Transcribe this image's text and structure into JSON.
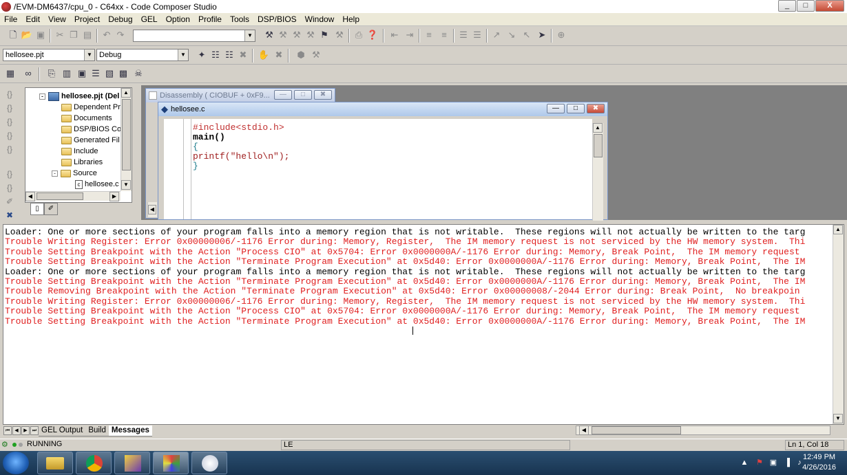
{
  "window": {
    "title": "/EVM-DM6437/cpu_0 - C64xx - Code Composer Studio",
    "min": "_",
    "max": "□",
    "close": "X"
  },
  "menu": [
    "File",
    "Edit",
    "View",
    "Project",
    "Debug",
    "GEL",
    "Option",
    "Profile",
    "Tools",
    "DSP/BIOS",
    "Window",
    "Help"
  ],
  "toolbar": {
    "find_value": "",
    "project_combo": "hellosee.pjt",
    "config_combo": "Debug"
  },
  "project_tree": {
    "root": "hellosee.pjt (Del",
    "items": [
      "Dependent Pr",
      "Documents",
      "DSP/BIOS Co",
      "Generated Fil",
      "Include",
      "Libraries",
      "Source"
    ],
    "file": "hellosee.c"
  },
  "windows": {
    "disassembly": {
      "title": "Disassembly ( CIOBUF  + 0xF9..."
    },
    "editor": {
      "title": "hellosee.c",
      "lines": [
        "#include<stdio.h>",
        "main()",
        "{",
        "printf(\"hello\\n\");",
        "}"
      ]
    }
  },
  "messages": [
    {
      "type": "info",
      "text": "Loader: One or more sections of your program falls into a memory region that is not writable.  These regions will not actually be written to the targ"
    },
    {
      "type": "err",
      "text": "Trouble Writing Register: Error 0x00000006/-1176 Error during: Memory, Register,  The IM memory request is not serviced by the HW memory system.  Thi"
    },
    {
      "type": "err",
      "text": "Trouble Setting Breakpoint with the Action \"Process CIO\" at 0x5704: Error 0x0000000A/-1176 Error during: Memory, Break Point,  The IM memory request"
    },
    {
      "type": "err",
      "text": "Trouble Setting Breakpoint with the Action \"Terminate Program Execution\" at 0x5d40: Error 0x0000000A/-1176 Error during: Memory, Break Point,  The IM"
    },
    {
      "type": "info",
      "text": "Loader: One or more sections of your program falls into a memory region that is not writable.  These regions will not actually be written to the targ"
    },
    {
      "type": "err",
      "text": "Trouble Setting Breakpoint with the Action \"Terminate Program Execution\" at 0x5d40: Error 0x0000000A/-1176 Error during: Memory, Break Point,  The IM"
    },
    {
      "type": "err",
      "text": "Trouble Removing Breakpoint with the Action \"Terminate Program Execution\" at 0x5d40: Error 0x00000008/-2044 Error during: Break Point,  No breakpoin"
    },
    {
      "type": "err",
      "text": "Trouble Writing Register: Error 0x00000006/-1176 Error during: Memory, Register,  The IM memory request is not serviced by the HW memory system.  Thi"
    },
    {
      "type": "err",
      "text": "Trouble Setting Breakpoint with the Action \"Process CIO\" at 0x5704: Error 0x0000000A/-1176 Error during: Memory, Break Point,  The IM memory request"
    },
    {
      "type": "err",
      "text": "Trouble Setting Breakpoint with the Action \"Terminate Program Execution\" at 0x5d40: Error 0x0000000A/-1176 Error during: Memory, Break Point,  The IM"
    }
  ],
  "output_tabs": [
    "GEL Output",
    "Build",
    "Messages"
  ],
  "status": {
    "state": "RUNNING",
    "endian": "LE",
    "position": "Ln 1, Col 18"
  },
  "clock": {
    "time": "12:49 PM",
    "date": "4/26/2016"
  },
  "colors": {
    "error": "#e02020",
    "keyword": "#c03030",
    "brace": "#1a7a8a"
  }
}
